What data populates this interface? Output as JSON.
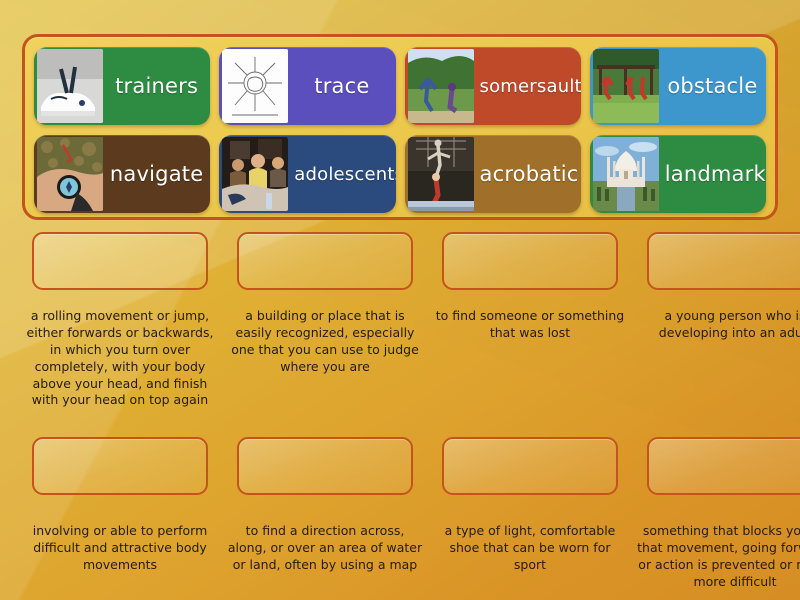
{
  "word_bank": {
    "tiles": [
      {
        "label": "trainers",
        "color": "#2e8b42",
        "image": "white-sneakers-photo"
      },
      {
        "label": "trace",
        "color": "#5a4fbd",
        "image": "line-drawing-sketch"
      },
      {
        "label": "somersaults",
        "color": "#bf4a2a",
        "image": "children-tumbling-outdoors-photo"
      },
      {
        "label": "obstacle",
        "color": "#3d96cc",
        "image": "children-obstacle-course-photo"
      },
      {
        "label": "navigate",
        "color": "#5c3a1e",
        "image": "hand-holding-compass-photo"
      },
      {
        "label": "adolescents",
        "color": "#2b4a7d",
        "image": "teenagers-in-classroom-photo"
      },
      {
        "label": "acrobatic",
        "color": "#a0702a",
        "image": "gymnast-acrobat-photo"
      },
      {
        "label": "landmarks",
        "color": "#2e8b42",
        "image": "taj-mahal-photo"
      }
    ]
  },
  "answers": {
    "rows": [
      [
        {
          "definition": "a rolling movement or jump, either forwards or backwards, in which you turn over completely, with your body above your head, and finish with your head on top again",
          "answer_value": ""
        },
        {
          "definition": "a building or place that is easily recognized, especially one that you can use to judge where you are",
          "answer_value": ""
        },
        {
          "definition": "to find someone or something that was lost",
          "answer_value": ""
        },
        {
          "definition": "a young person who is developing into an adult",
          "answer_value": ""
        }
      ],
      [
        {
          "definition": "involving or able to perform difficult and attractive body movements",
          "answer_value": ""
        },
        {
          "definition": "to find a direction across, along, or over an area of water or land, often by using a map",
          "answer_value": ""
        },
        {
          "definition": "a type of light, comfortable shoe that can be worn for sport",
          "answer_value": ""
        },
        {
          "definition": "something that blocks you so that movement, going forward, or action is prevented or made more difficult",
          "answer_value": ""
        }
      ]
    ]
  },
  "theme": {
    "background_top": "#e6c33f",
    "background_bottom": "#d68e24",
    "panel_border": "#c4541c",
    "panel_fill": "#ecc94e",
    "drop_zone_border": "#c4541c",
    "definition_text": "#241c10"
  }
}
